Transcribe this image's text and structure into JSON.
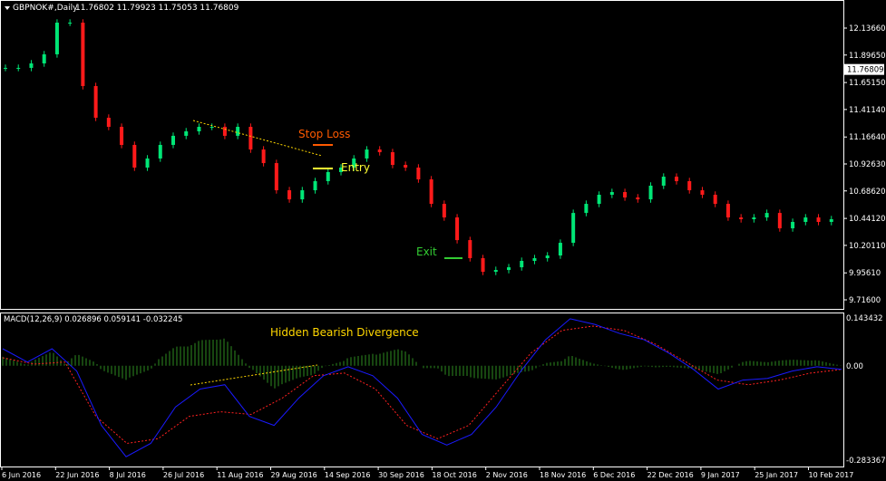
{
  "header": {
    "symbol": "GBPNOK#,Daily",
    "ohlc": "11.76802 11.79923 11.75053 11.76809"
  },
  "macd_header": "MACD(12,26,9) 0.026896 0.059141 -0.032245",
  "annotations": {
    "stop_loss": "Stop Loss",
    "entry": "Entry",
    "exit": "Exit",
    "divergence": "Hidden Bearish Divergence"
  },
  "colors": {
    "bull": "#00e676",
    "bear": "#ff1a1a",
    "macd": "#1a1aff",
    "signal": "#ff2020",
    "histogram": "#2e8b20",
    "trend": "#ffd700",
    "stop": "#ff5a00",
    "entry": "#ffff33",
    "exit": "#33cc33",
    "axis": "#ffffff"
  },
  "chart_data": [
    {
      "type": "candlestick",
      "title": "GBPNOK#,Daily",
      "y_ticks": [
        "12.13660",
        "11.89650",
        "11.65150",
        "11.41140",
        "11.16640",
        "10.92630",
        "10.68620",
        "10.44120",
        "10.20110",
        "9.95610",
        "9.71600"
      ],
      "ylim": [
        9.716,
        12.1366
      ],
      "current_price": "11.76809",
      "x_ticks": [
        "6 Jun 2016",
        "22 Jun 2016",
        "8 Jul 2016",
        "26 Jul 2016",
        "11 Aug 2016",
        "29 Aug 2016",
        "14 Sep 2016",
        "30 Sep 2016",
        "18 Oct 2016",
        "2 Nov 2016",
        "18 Nov 2016",
        "6 Dec 2016",
        "22 Dec 2016",
        "9 Jan 2017",
        "25 Jan 2017",
        "10 Feb 2017"
      ],
      "closes": [
        11.782,
        11.782,
        11.822,
        11.903,
        12.185,
        12.185,
        11.62,
        11.338,
        11.257,
        11.096,
        10.894,
        10.975,
        11.096,
        11.177,
        11.217,
        11.257,
        11.257,
        11.177,
        11.257,
        11.055,
        10.934,
        10.692,
        10.611,
        10.692,
        10.773,
        10.854,
        10.894,
        10.975,
        11.055,
        11.031,
        10.918,
        10.894,
        10.789,
        10.571,
        10.45,
        10.248,
        10.087,
        9.966,
        9.982,
        10.006,
        10.063,
        10.087,
        10.111,
        10.224,
        10.49,
        10.571,
        10.652,
        10.676,
        10.628,
        10.611,
        10.733,
        10.813,
        10.773,
        10.692,
        10.652,
        10.571,
        10.45,
        10.434,
        10.45,
        10.49,
        10.353,
        10.41,
        10.45,
        10.41,
        10.434
      ]
    },
    {
      "type": "line",
      "title": "MACD(12,26,9)",
      "y_ticks": [
        "0.143432",
        "0.00",
        "-0.283367"
      ],
      "ylim": [
        -0.283367,
        0.143432
      ],
      "series": [
        {
          "name": "MACD",
          "values": [
            0.051,
            0.011,
            0.051,
            -0.016,
            -0.179,
            -0.273,
            -0.233,
            -0.124,
            -0.07,
            -0.057,
            -0.152,
            -0.179,
            -0.097,
            -0.03,
            -0.003,
            -0.03,
            -0.097,
            -0.206,
            -0.238,
            -0.206,
            -0.124,
            -0.016,
            0.078,
            0.141,
            0.124,
            0.097,
            0.078,
            0.038,
            -0.011,
            -0.07,
            -0.043,
            -0.038,
            -0.016,
            -0.003,
            -0.011
          ]
        },
        {
          "name": "Signal",
          "values": [
            0.024,
            0.005,
            0.011,
            -0.152,
            -0.233,
            -0.219,
            -0.152,
            -0.138,
            -0.146,
            -0.097,
            -0.03,
            -0.022,
            -0.07,
            -0.179,
            -0.219,
            -0.179,
            -0.07,
            0.038,
            0.106,
            0.119,
            0.106,
            0.065,
            0.011,
            -0.043,
            -0.057,
            -0.043,
            -0.022,
            -0.011
          ]
        }
      ]
    }
  ]
}
